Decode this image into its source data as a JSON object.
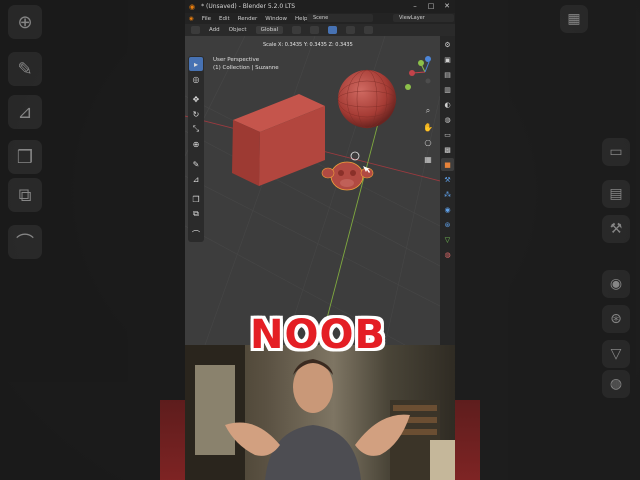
{
  "window": {
    "title": "* (Unsaved) - Blender 5.2.0 LTS",
    "controls": [
      "–",
      "□",
      "✕"
    ]
  },
  "menu": {
    "items": [
      "File",
      "Edit",
      "Render",
      "Window",
      "Help"
    ],
    "scene": "Scene",
    "view_layer": "ViewLayer"
  },
  "header": {
    "add": "Add",
    "object": "Object",
    "orientation": "Global"
  },
  "viewport": {
    "status": "Scale X: 0.3435   Y: 0.3435   Z: 0.3435",
    "perspective": "User Perspective",
    "collection": "(1) Collection | Suzanne",
    "gizmo_labels": [
      "Y",
      "X",
      "Z"
    ]
  },
  "overlay_text": "NOOB",
  "colors": {
    "selected_tool": "#4772b3",
    "object_red": "#b5443c",
    "noob_red": "#e41e24",
    "x_axis": "#c3434a",
    "y_axis": "#8cc04a"
  }
}
